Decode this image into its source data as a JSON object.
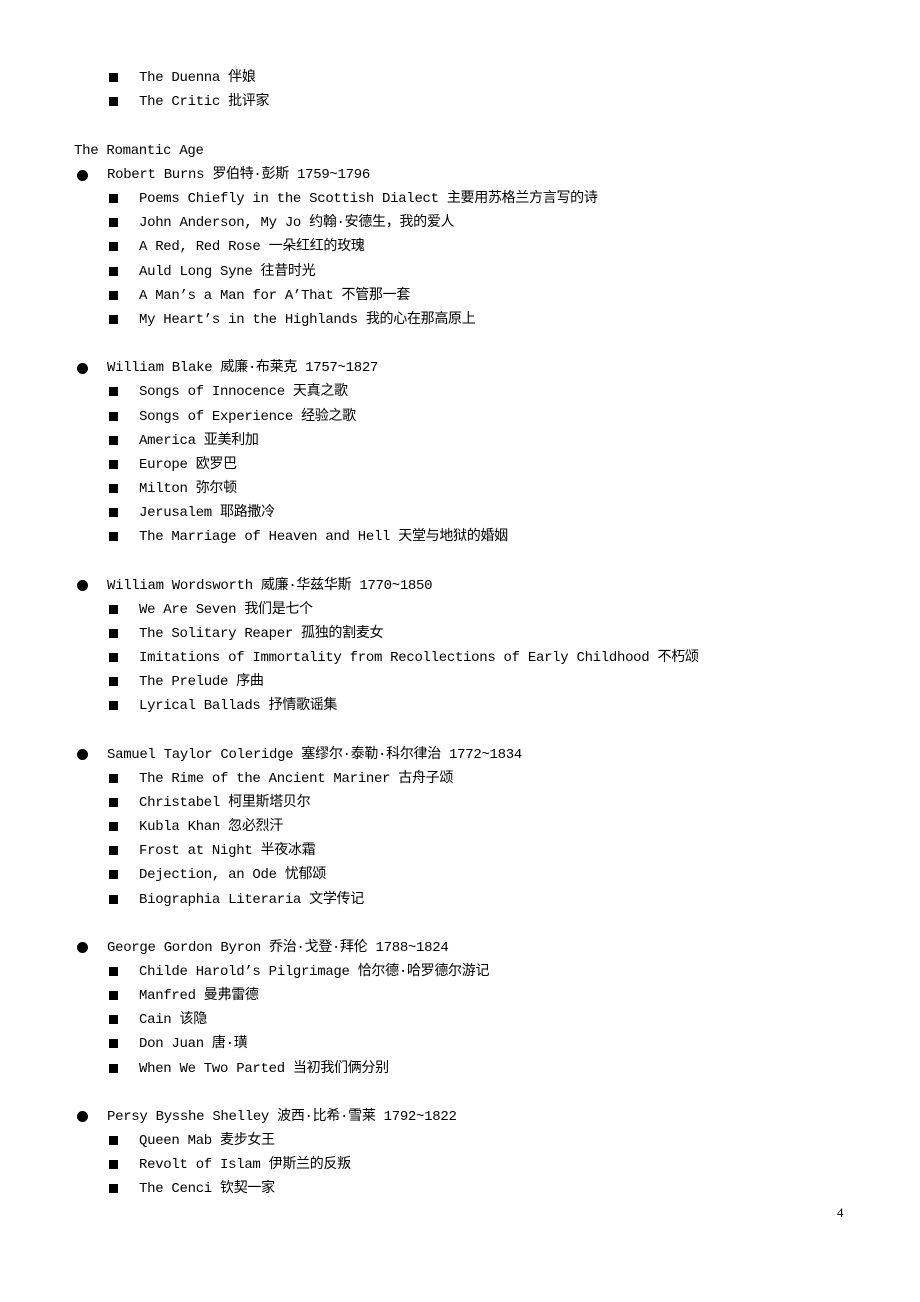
{
  "continued_works": [
    "The Duenna 伴娘",
    "The Critic 批评家"
  ],
  "section_title": "The Romantic Age",
  "authors": [
    {
      "name": "Robert Burns 罗伯特·彭斯 1759~1796",
      "works": [
        "Poems Chiefly in the Scottish Dialect 主要用苏格兰方言写的诗",
        "John Anderson, My Jo 约翰·安德生，我的爱人",
        "A Red, Red Rose 一朵红红的玫瑰",
        "Auld Long Syne 往昔时光",
        "A Man’s a Man for A’That 不管那一套",
        "My Heart’s in the Highlands 我的心在那高原上"
      ]
    },
    {
      "name": "William Blake 威廉·布莱克 1757~1827",
      "works": [
        "Songs of Innocence 天真之歌",
        "Songs of Experience 经验之歌",
        "America 亚美利加",
        "Europe 欧罗巴",
        "Milton 弥尔顿",
        "Jerusalem 耶路撒冷",
        "The Marriage of Heaven and Hell 天堂与地狱的婚姻"
      ]
    },
    {
      "name": "William Wordsworth 威廉·华兹华斯 1770~1850",
      "works": [
        "We Are Seven 我们是七个",
        "The Solitary Reaper 孤独的割麦女",
        "Imitations of Immortality from Recollections of Early Childhood 不朽颂",
        "The Prelude 序曲",
        "Lyrical Ballads 抒情歌谣集"
      ]
    },
    {
      "name": "Samuel Taylor Coleridge 塞缪尔·泰勒·科尔律治 1772~1834",
      "works": [
        "The Rime of the Ancient Mariner 古舟子颂",
        "Christabel 柯里斯塔贝尔",
        "Kubla Khan 忽必烈汗",
        "Frost at Night 半夜冰霜",
        "Dejection, an Ode 忧郁颂",
        "Biographia Literaria 文学传记"
      ]
    },
    {
      "name": "George Gordon Byron 乔治·戈登·拜伦 1788~1824",
      "works": [
        "Childe Harold’s Pilgrimage 恰尔德·哈罗德尔游记",
        "Manfred 曼弗雷德",
        "Cain 该隐",
        "Don Juan 唐·璜",
        "When We Two Parted 当初我们俩分别"
      ]
    },
    {
      "name": "Persy Bysshe Shelley 波西·比希·雪莱 1792~1822",
      "works": [
        "Queen Mab 麦步女王",
        "Revolt of Islam 伊斯兰的反叛",
        "The Cenci 钦契一家"
      ]
    }
  ],
  "page_number": "4"
}
